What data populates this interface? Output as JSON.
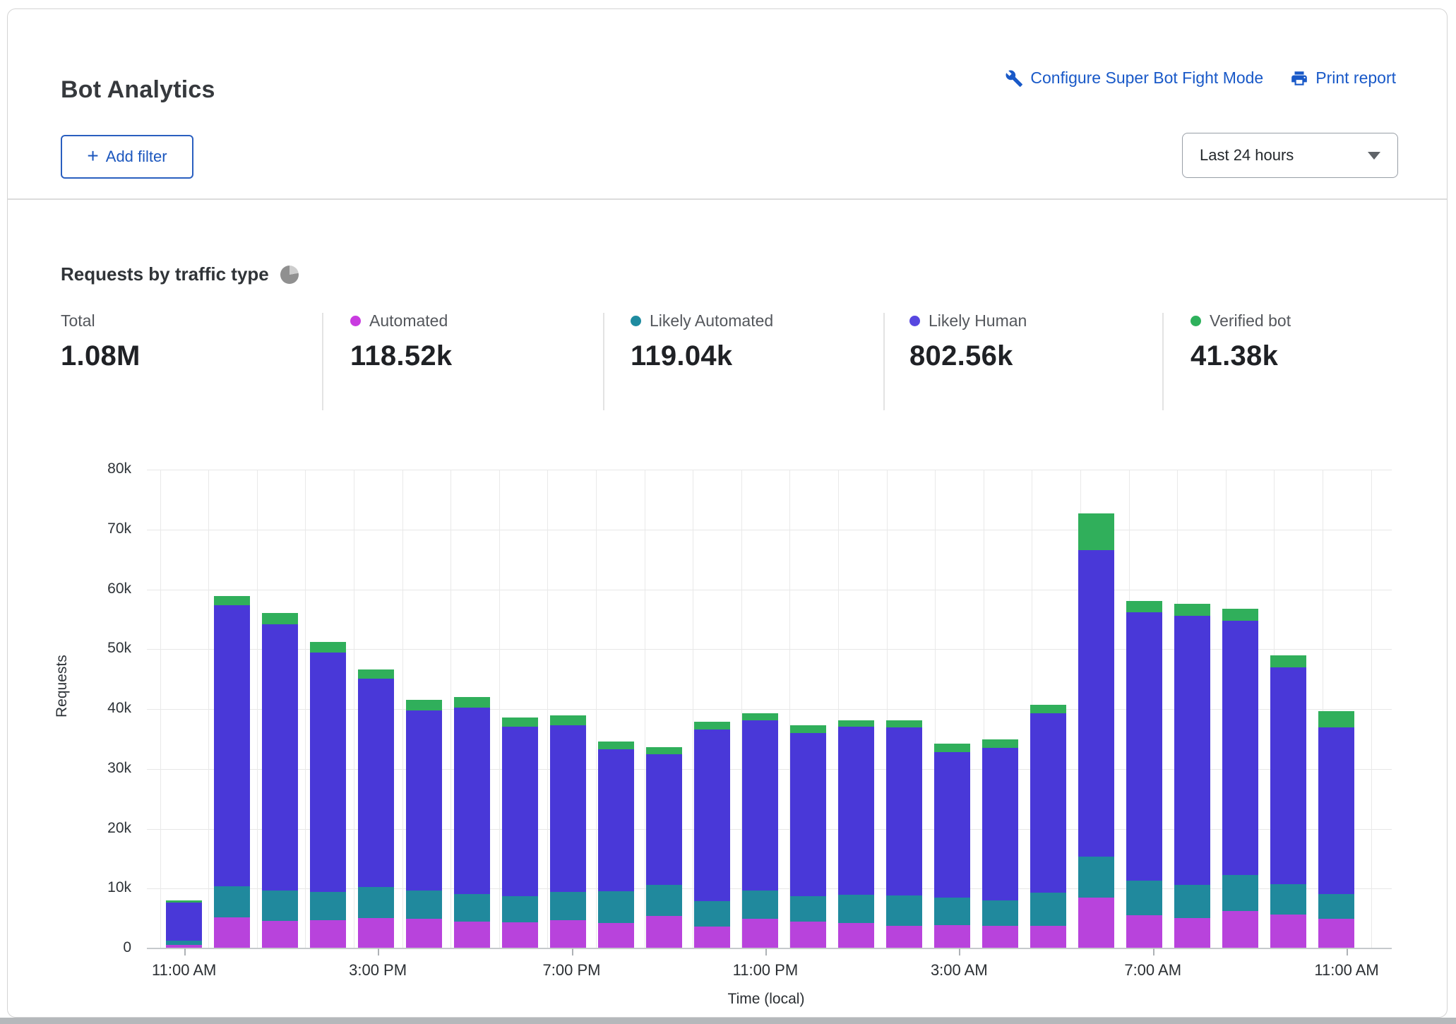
{
  "header": {
    "title": "Bot Analytics",
    "configure_link": "Configure Super Bot Fight Mode",
    "print_link": "Print report",
    "add_filter_label": "Add filter",
    "plus_glyph": "+",
    "time_range_value": "Last 24 hours"
  },
  "section": {
    "title": "Requests by traffic type"
  },
  "stats": [
    {
      "label": "Total",
      "value": "1.08M",
      "dot": null
    },
    {
      "label": "Automated",
      "value": "118.52k",
      "dot": "#c93be0"
    },
    {
      "label": "Likely Automated",
      "value": "119.04k",
      "dot": "#1e8ba0"
    },
    {
      "label": "Likely Human",
      "value": "802.56k",
      "dot": "#5747e0"
    },
    {
      "label": "Verified bot",
      "value": "41.38k",
      "dot": "#2eb15c"
    }
  ],
  "colors": {
    "link_blue": "#1959c8",
    "automated": "#b843dc",
    "likely_automated": "#20899d",
    "likely_human": "#4938d8",
    "verified_bot": "#30af5b"
  },
  "chart_data": {
    "type": "bar",
    "stacked": true,
    "title": "Requests by traffic type",
    "xlabel": "Time (local)",
    "ylabel": "Requests",
    "unit": "thousands of requests",
    "ylim": [
      0,
      80
    ],
    "grid": true,
    "categories": [
      "11:00 AM",
      "12:00 PM",
      "1:00 PM",
      "2:00 PM",
      "3:00 PM",
      "4:00 PM",
      "5:00 PM",
      "6:00 PM",
      "7:00 PM",
      "8:00 PM",
      "9:00 PM",
      "10:00 PM",
      "11:00 PM",
      "12:00 AM",
      "1:00 AM",
      "2:00 AM",
      "3:00 AM",
      "4:00 AM",
      "5:00 AM",
      "6:00 AM",
      "7:00 AM",
      "8:00 AM",
      "9:00 AM",
      "10:00 AM",
      "11:00 AM"
    ],
    "series": [
      {
        "name": "Automated",
        "color_key": "automated",
        "values": [
          0.6,
          5.2,
          4.6,
          4.7,
          5.1,
          4.9,
          4.5,
          4.4,
          4.7,
          4.3,
          5.4,
          3.7,
          5.0,
          4.5,
          4.2,
          3.8,
          3.9,
          3.8,
          3.8,
          8.5,
          5.6,
          5.1,
          6.3,
          5.7,
          4.9
        ]
      },
      {
        "name": "Likely Automated",
        "color_key": "likely_automated",
        "values": [
          0.7,
          5.2,
          5.1,
          4.7,
          5.2,
          4.8,
          4.6,
          4.3,
          4.7,
          5.3,
          5.2,
          4.2,
          4.7,
          4.2,
          4.8,
          5.1,
          4.6,
          4.2,
          5.5,
          6.8,
          5.7,
          5.5,
          6.0,
          5.0,
          4.2
        ]
      },
      {
        "name": "Likely Human",
        "color_key": "likely_human",
        "values": [
          6.4,
          47.0,
          44.5,
          40.1,
          34.8,
          30.1,
          31.1,
          28.3,
          27.9,
          23.7,
          21.9,
          28.7,
          28.4,
          27.3,
          28.0,
          28.0,
          24.3,
          25.5,
          30.0,
          51.3,
          44.9,
          45.0,
          42.4,
          36.3,
          27.8
        ]
      },
      {
        "name": "Verified bot",
        "color_key": "verified_bot",
        "values": [
          0.3,
          1.5,
          1.8,
          1.7,
          1.5,
          1.7,
          1.8,
          1.6,
          1.6,
          1.3,
          1.1,
          1.3,
          1.2,
          1.3,
          1.1,
          1.2,
          1.4,
          1.4,
          1.4,
          6.1,
          1.9,
          2.0,
          2.0,
          2.0,
          2.7
        ]
      }
    ],
    "y_ticks": [
      {
        "v": 0,
        "label": "0"
      },
      {
        "v": 10,
        "label": "10k"
      },
      {
        "v": 20,
        "label": "20k"
      },
      {
        "v": 30,
        "label": "30k"
      },
      {
        "v": 40,
        "label": "40k"
      },
      {
        "v": 50,
        "label": "50k"
      },
      {
        "v": 60,
        "label": "60k"
      },
      {
        "v": 70,
        "label": "70k"
      },
      {
        "v": 80,
        "label": "80k"
      }
    ],
    "x_ticks": [
      {
        "index": 0,
        "label": "11:00 AM"
      },
      {
        "index": 4,
        "label": "3:00 PM"
      },
      {
        "index": 8,
        "label": "7:00 PM"
      },
      {
        "index": 12,
        "label": "11:00 PM"
      },
      {
        "index": 16,
        "label": "3:00 AM"
      },
      {
        "index": 20,
        "label": "7:00 AM"
      },
      {
        "index": 24,
        "label": "11:00 AM"
      }
    ]
  }
}
